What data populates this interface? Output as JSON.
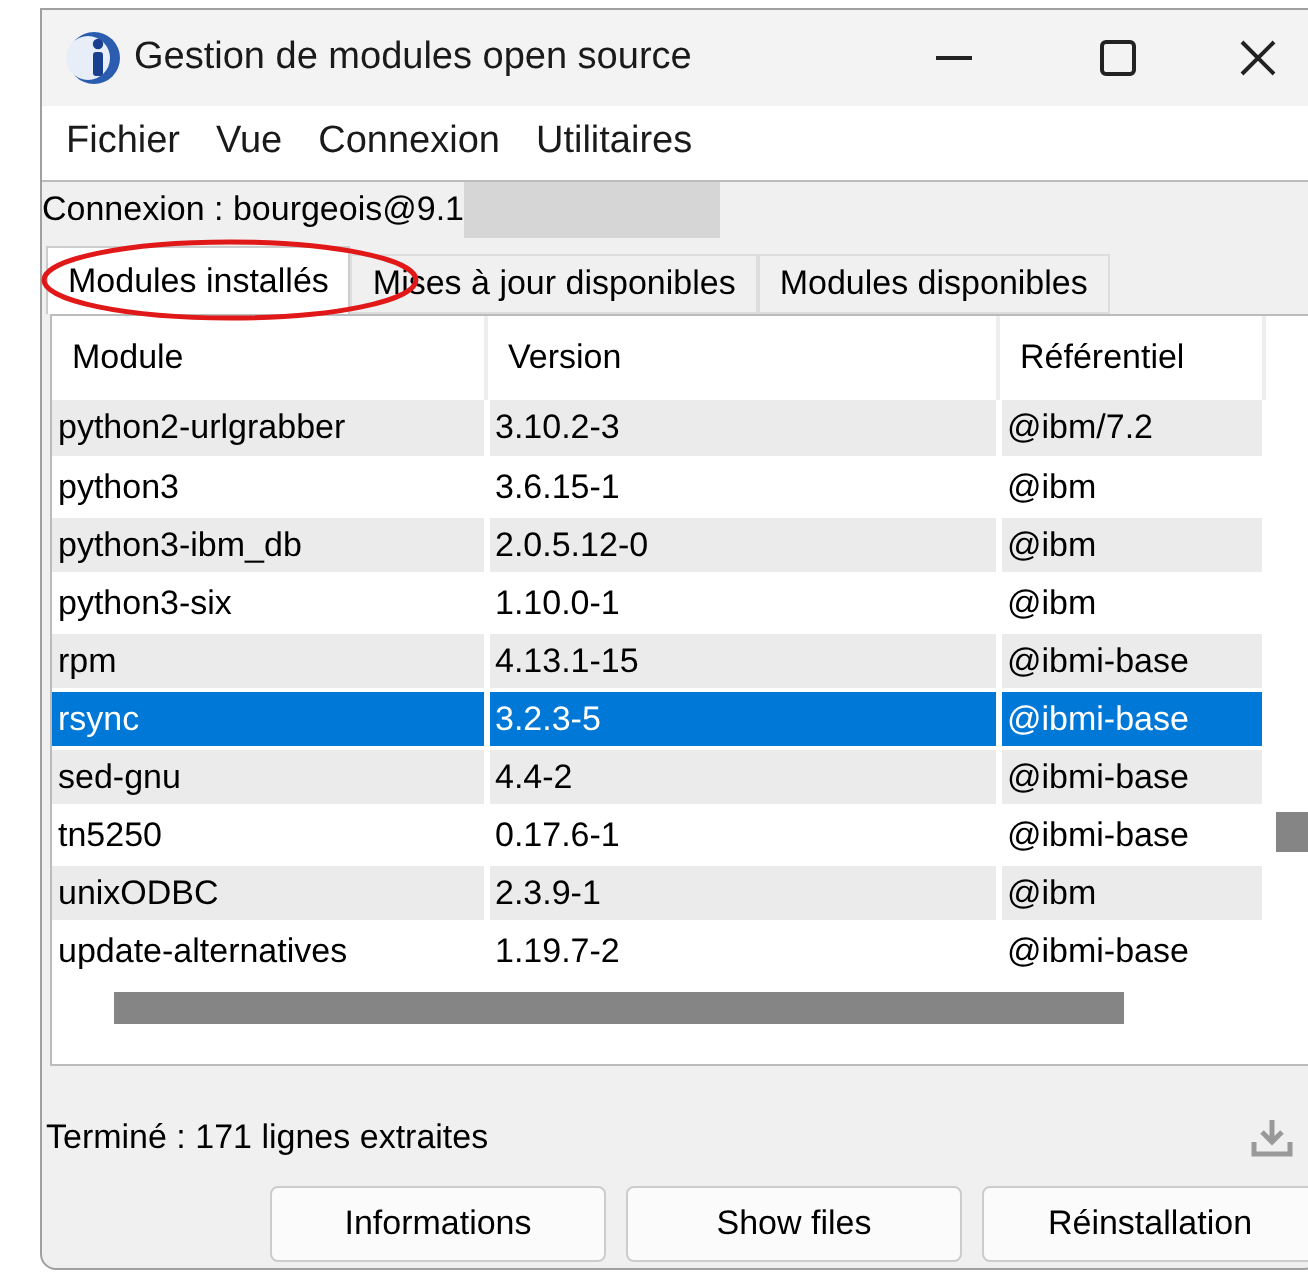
{
  "window": {
    "title": "Gestion de modules open source"
  },
  "menu": [
    "Fichier",
    "Vue",
    "Connexion",
    "Utilitaires"
  ],
  "connection": {
    "label": "Connexion : bourgeois@9.1"
  },
  "tabs": [
    {
      "label": "Modules installés",
      "selected": true
    },
    {
      "label": "Mises à jour disponibles",
      "selected": false
    },
    {
      "label": "Modules disponibles",
      "selected": false
    }
  ],
  "table": {
    "columns": [
      "Module",
      "Version",
      "Référentiel"
    ],
    "rows": [
      {
        "cells": [
          "python2-urlgrabber",
          "3.10.2-3",
          "@ibm/7.2"
        ],
        "selected": false
      },
      {
        "cells": [
          "python3",
          "3.6.15-1",
          "@ibm"
        ],
        "selected": false
      },
      {
        "cells": [
          "python3-ibm_db",
          "2.0.5.12-0",
          "@ibm"
        ],
        "selected": false
      },
      {
        "cells": [
          "python3-six",
          "1.10.0-1",
          "@ibm"
        ],
        "selected": false
      },
      {
        "cells": [
          "rpm",
          "4.13.1-15",
          "@ibmi-base"
        ],
        "selected": false
      },
      {
        "cells": [
          "rsync",
          "3.2.3-5",
          "@ibmi-base"
        ],
        "selected": true
      },
      {
        "cells": [
          "sed-gnu",
          "4.4-2",
          "@ibmi-base"
        ],
        "selected": false
      },
      {
        "cells": [
          "tn5250",
          "0.17.6-1",
          "@ibmi-base"
        ],
        "selected": false
      },
      {
        "cells": [
          "unixODBC",
          "2.3.9-1",
          "@ibm"
        ],
        "selected": false
      },
      {
        "cells": [
          "update-alternatives",
          "1.19.7-2",
          "@ibmi-base"
        ],
        "selected": false
      }
    ]
  },
  "status_bar": {
    "text": "Terminé : 171 lignes extraites"
  },
  "buttons": [
    "Informations",
    "Show files",
    "Réinstallation"
  ]
}
